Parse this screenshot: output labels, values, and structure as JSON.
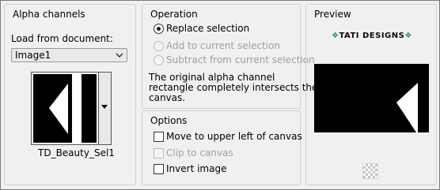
{
  "alpha_channels": {
    "title": "Alpha channels",
    "load_label": "Load from document:",
    "document_value": "Image1",
    "selection_name": "TD_Beauty_Sel1"
  },
  "operation": {
    "title": "Operation",
    "options": [
      {
        "label": "Replace selection",
        "selected": true,
        "enabled": true
      },
      {
        "label": "Add to current selection",
        "selected": false,
        "enabled": false
      },
      {
        "label": "Subtract from current selection",
        "selected": false,
        "enabled": false
      }
    ],
    "message_lines": [
      "The original alpha channel",
      "rectangle completely intersects the",
      "canvas."
    ]
  },
  "options": {
    "title": "Options",
    "items": [
      {
        "label": "Move to upper left of canvas",
        "checked": false,
        "enabled": true
      },
      {
        "label": "Clip to canvas",
        "checked": false,
        "enabled": false
      },
      {
        "label": "Invert image",
        "checked": false,
        "enabled": true
      }
    ]
  },
  "preview": {
    "title": "Preview",
    "logo_text": "TATI DESIGNS"
  },
  "colors": {
    "background": "#f0f0f0",
    "group_border": "#d0d0d0",
    "disabled_text": "#a0a0a0",
    "preview_fill": "#000000"
  }
}
